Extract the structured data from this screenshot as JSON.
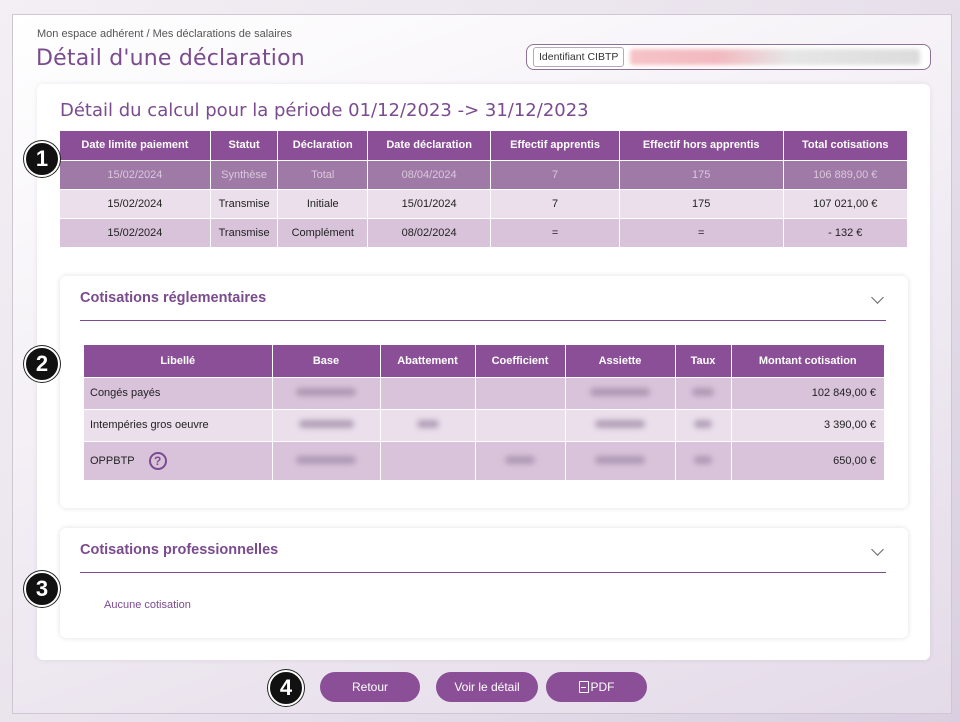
{
  "breadcrumb": "Mon espace adhérent / Mes déclarations de salaires",
  "page_title": "Détail d'une déclaration",
  "identifier": {
    "label": "Identifiant CIBTP"
  },
  "period_title": "Détail du calcul pour la période 01/12/2023 -> 31/12/2023",
  "summary_table": {
    "headers": [
      "Date limite paiement",
      "Statut",
      "Déclaration",
      "Date déclaration",
      "Effectif apprentis",
      "Effectif hors apprentis",
      "Total cotisations"
    ],
    "rows": [
      [
        "15/02/2024",
        "Synthèse",
        "Total",
        "08/04/2024",
        "7",
        "175",
        "106 889,00 €"
      ],
      [
        "15/02/2024",
        "Transmise",
        "Initiale",
        "15/01/2024",
        "7",
        "175",
        "107 021,00 €"
      ],
      [
        "15/02/2024",
        "Transmise",
        "Complément",
        "08/02/2024",
        "=",
        "=",
        "- 132 €"
      ]
    ]
  },
  "regulatory": {
    "title": "Cotisations réglementaires",
    "headers": [
      "Libellé",
      "Base",
      "Abattement",
      "Coefficient",
      "Assiette",
      "Taux",
      "Montant cotisation"
    ],
    "rows": [
      {
        "label": "Congés payés",
        "amount": "102 849,00 €"
      },
      {
        "label": "Intempéries gros oeuvre",
        "amount": "3 390,00 €"
      },
      {
        "label": "OPPBTP",
        "amount": "650,00 €"
      }
    ]
  },
  "professional": {
    "title": "Cotisations professionnelles",
    "empty_text": "Aucune cotisation"
  },
  "badges": [
    "1",
    "2",
    "3",
    "4"
  ],
  "buttons": {
    "back": "Retour",
    "detail": "Voir le détail",
    "pdf": "PDF"
  },
  "icons": {
    "help": "question-circle-icon",
    "chevron": "chevron-down-icon",
    "pdf": "pdf-file-icon"
  },
  "colors": {
    "accent": "#8a4f97",
    "title": "#7a4b8f"
  }
}
